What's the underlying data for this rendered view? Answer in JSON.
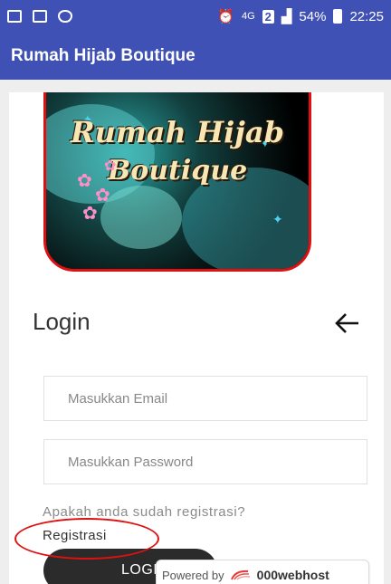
{
  "status_bar": {
    "network": "4G",
    "sim": "2",
    "battery": "54%",
    "time": "22:25"
  },
  "app_bar": {
    "title": "Rumah Hijab Boutique"
  },
  "logo": {
    "line1": "Rumah Hijab",
    "line2": "Boutique"
  },
  "login": {
    "title": "Login",
    "back_icon": "arrow-left",
    "email_placeholder": "Masukkan Email",
    "password_placeholder": "Masukkan Password",
    "question": "Apakah anda sudah registrasi?",
    "register_link": "Registrasi",
    "login_button": "LOGIN"
  },
  "badge": {
    "powered": "Powered by",
    "host": "000webhost"
  },
  "colors": {
    "primary": "#3f51b5",
    "button": "#2b2b2b",
    "annotation": "#e01010"
  }
}
